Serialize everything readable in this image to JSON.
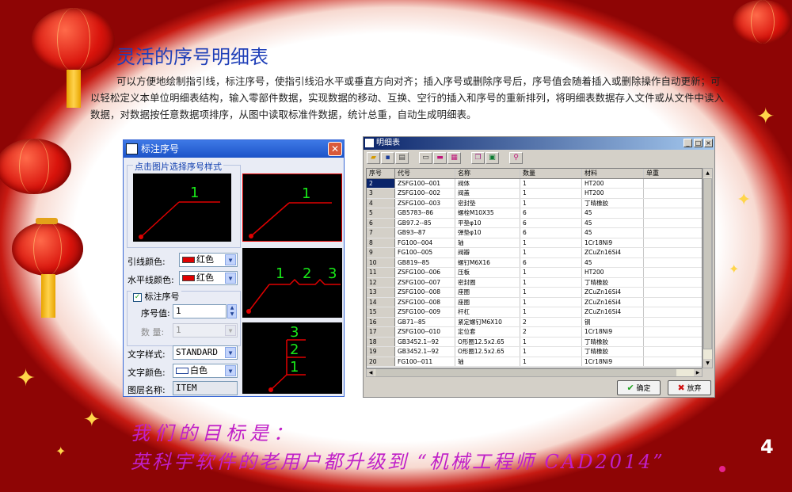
{
  "slide": {
    "title": "灵活的序号明细表",
    "description": "可以方便地绘制指引线，标注序号，使指引线沿水平或垂直方向对齐；插入序号或删除序号后，序号值会随着插入或删除操作自动更新；可以轻松定义本单位明细表结构，输入零部件数据，实现数据的移动、互换、空行的插入和序号的重新排列，将明细表数据存入文件或从文件中读入数据，对数据按任意数据项排序，从图中读取标准件数据，统计总重，自动生成明细表。",
    "goal_line1": "我们的目标是：",
    "goal_line2": "英科宇软件的老用户都升级到 “机械工程师 CAD2014”",
    "page_number": "4"
  },
  "dialog": {
    "title": "标注序号",
    "close_glyph": "✕",
    "group_label": "点击图片选择序号样式",
    "style_single": "1",
    "style_multi": [
      "1",
      "2",
      "3"
    ],
    "style_stack": [
      "3",
      "2",
      "1"
    ],
    "leader_color_label": "引线颜色:",
    "leader_color_value": "红色",
    "hline_color_label": "水平线颜色:",
    "hline_color_value": "红色",
    "mark_checkbox_label": "标注序号",
    "seq_label": "序号值:",
    "seq_value": "1",
    "qty_label": "数  量:",
    "qty_value": "1",
    "text_style_label": "文字样式:",
    "text_style_value": "STANDARD",
    "text_color_label": "文字颜色:",
    "text_color_value": "白色",
    "layer_label": "图层名称:",
    "layer_value": "ITEM",
    "colors": {
      "red": "#e00000",
      "green": "#18e818",
      "white": "#ffffff"
    }
  },
  "table_window": {
    "title": "明细表",
    "win_buttons": [
      "_",
      "□",
      "×"
    ],
    "headers": [
      "序号",
      "代号",
      "名称",
      "数量",
      "材料",
      "单重"
    ],
    "rows": [
      [
        "2",
        "ZSFG100--001",
        "阀体",
        "1",
        "HT200",
        ""
      ],
      [
        "3",
        "ZSFG100--002",
        "阀盖",
        "1",
        "HT200",
        ""
      ],
      [
        "4",
        "ZSFG100--003",
        "密封垫",
        "1",
        "丁晴橡胶",
        ""
      ],
      [
        "5",
        "GB5783--86",
        "螺栓M10X35",
        "6",
        "45",
        ""
      ],
      [
        "6",
        "GB97.2--85",
        "平垫φ10",
        "6",
        "45",
        ""
      ],
      [
        "7",
        "GB93--87",
        "弹垫φ10",
        "6",
        "45",
        ""
      ],
      [
        "8",
        "FG100--004",
        "轴",
        "1",
        "1Cr18Ni9",
        ""
      ],
      [
        "9",
        "FG100--005",
        "阀瓣",
        "1",
        "ZCuZn16Si4",
        ""
      ],
      [
        "10",
        "GB819--85",
        "螺钉M6X16",
        "6",
        "45",
        ""
      ],
      [
        "11",
        "ZSFG100--006",
        "压板",
        "1",
        "HT200",
        ""
      ],
      [
        "12",
        "ZSFG100--007",
        "密封圈",
        "1",
        "丁晴橡胶",
        ""
      ],
      [
        "13",
        "ZSFG100--008",
        "座圈",
        "1",
        "ZCuZn16Si4",
        ""
      ],
      [
        "14",
        "ZSFG100--008",
        "座圈",
        "1",
        "ZCuZn16Si4",
        ""
      ],
      [
        "15",
        "ZSFG100--009",
        "杆杠",
        "1",
        "ZCuZn16Si4",
        ""
      ],
      [
        "16",
        "GB71--85",
        "紧定螺钉M6X10",
        "2",
        "钢",
        ""
      ],
      [
        "17",
        "ZSFG100--010",
        "定位套",
        "2",
        "1Cr18Ni9",
        ""
      ],
      [
        "18",
        "GB3452.1--92",
        "O形圈12.5x2.65",
        "1",
        "丁晴橡胶",
        ""
      ],
      [
        "19",
        "GB3452.1--92",
        "O形圈12.5x2.65",
        "1",
        "丁晴橡胶",
        ""
      ],
      [
        "20",
        "FG100--011",
        "轴",
        "1",
        "1Cr18Ni9",
        ""
      ]
    ],
    "ok_label": "确定",
    "cancel_label": "放弃"
  }
}
